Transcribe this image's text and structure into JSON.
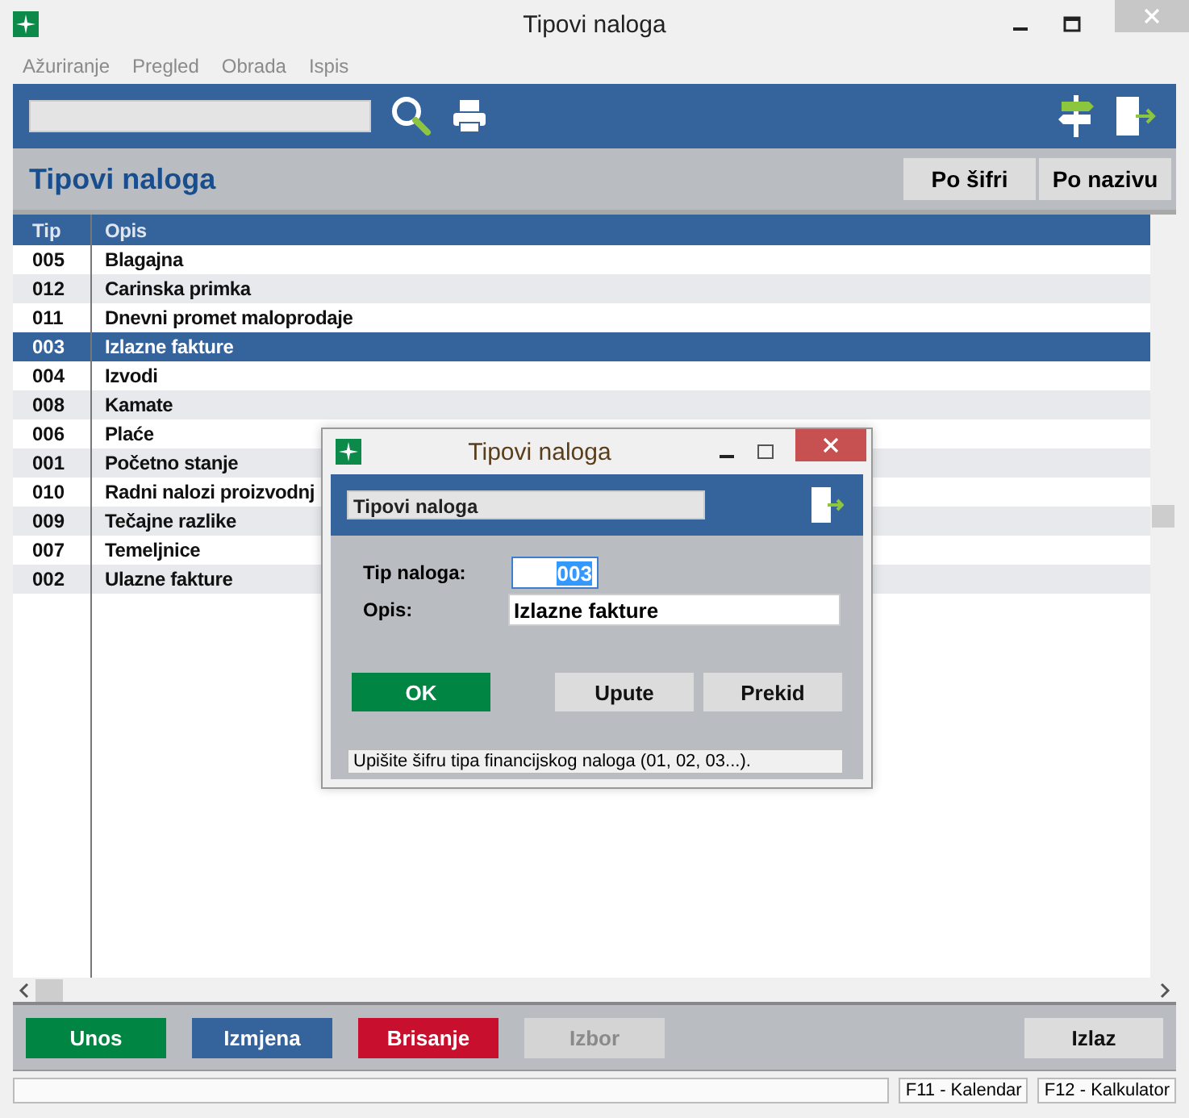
{
  "window": {
    "title": "Tipovi naloga"
  },
  "menu": [
    {
      "label": "Ažuriranje"
    },
    {
      "label": "Pregled"
    },
    {
      "label": "Obrada"
    },
    {
      "label": "Ispis"
    }
  ],
  "header": {
    "title": "Tipovi naloga",
    "sort_buttons": [
      {
        "label": "Po šifri"
      },
      {
        "label": "Po nazivu"
      }
    ]
  },
  "table": {
    "columns": [
      "Tip",
      "Opis"
    ],
    "rows": [
      {
        "tip": "005",
        "opis": "Blagajna",
        "selected": false
      },
      {
        "tip": "012",
        "opis": "Carinska primka",
        "selected": false
      },
      {
        "tip": "011",
        "opis": "Dnevni promet maloprodaje",
        "selected": false
      },
      {
        "tip": "003",
        "opis": "Izlazne fakture",
        "selected": true
      },
      {
        "tip": "004",
        "opis": "Izvodi",
        "selected": false
      },
      {
        "tip": "008",
        "opis": "Kamate",
        "selected": false
      },
      {
        "tip": "006",
        "opis": "Plaće",
        "selected": false
      },
      {
        "tip": "001",
        "opis": "Početno stanje",
        "selected": false
      },
      {
        "tip": "010",
        "opis": "Radni nalozi proizvodnj",
        "selected": false
      },
      {
        "tip": "009",
        "opis": "Tečajne razlike",
        "selected": false
      },
      {
        "tip": "007",
        "opis": "Temeljnice",
        "selected": false
      },
      {
        "tip": "002",
        "opis": "Ulazne fakture",
        "selected": false
      }
    ]
  },
  "buttons": [
    {
      "label": "Unos",
      "kind": "green",
      "disabled": false
    },
    {
      "label": "Izmjena",
      "kind": "blue",
      "disabled": false
    },
    {
      "label": "Brisanje",
      "kind": "red",
      "disabled": false
    },
    {
      "label": "Izbor",
      "kind": "plain",
      "disabled": true
    },
    {
      "label": "Izlaz",
      "kind": "plain",
      "disabled": false
    }
  ],
  "status_bar": [
    {
      "text": "F11 - Kalendar"
    },
    {
      "text": "F12 - Kalkulator"
    }
  ],
  "dialog": {
    "title": "Tipovi naloga",
    "subtitle": "Tipovi naloga",
    "fields": [
      {
        "label": "Tip naloga:",
        "value": "003",
        "kind": "code",
        "selected": true
      },
      {
        "label": "Opis:",
        "value": "Izlazne fakture",
        "kind": "text",
        "selected": false
      }
    ],
    "buttons": [
      {
        "label": "OK",
        "kind": "green"
      },
      {
        "label": "Upute",
        "kind": "plain"
      },
      {
        "label": "Prekid",
        "kind": "plain"
      }
    ],
    "hint": "Upišite šifru tipa financijskog naloga (01, 02, 03...)."
  }
}
